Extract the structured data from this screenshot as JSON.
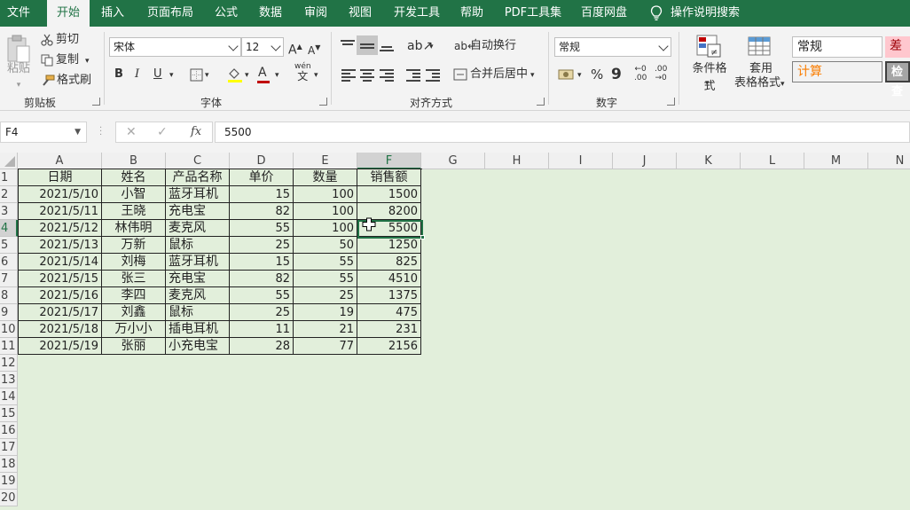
{
  "menu": {
    "tabs": [
      "文件",
      "开始",
      "插入",
      "页面布局",
      "公式",
      "数据",
      "审阅",
      "视图",
      "开发工具",
      "帮助",
      "PDF工具集",
      "百度网盘"
    ],
    "active": "开始",
    "search_label": "操作说明搜索"
  },
  "ribbon": {
    "clipboard": {
      "paste": "粘贴",
      "cut": "剪切",
      "copy": "复制",
      "format_painter": "格式刷",
      "label": "剪贴板"
    },
    "font": {
      "name": "宋体",
      "size": "12",
      "grow": "A",
      "shrink": "A",
      "bold": "B",
      "italic": "I",
      "underline": "U",
      "phonetic": "wén",
      "label": "字体"
    },
    "alignment": {
      "wrap": "自动换行",
      "merge": "合并后居中",
      "label": "对齐方式"
    },
    "number": {
      "format": "常规",
      "percent": "%",
      "comma": "9",
      "label": "数字"
    },
    "styles": {
      "conditional": "条件格式",
      "table_format_1": "套用",
      "table_format_2": "表格格式",
      "normal": "常规",
      "bad": "差",
      "calc": "计算",
      "check": "检查"
    }
  },
  "formula_bar": {
    "name_box": "F4",
    "cancel": "✕",
    "enter": "✓",
    "fx": "fx",
    "value": "5500"
  },
  "columns": [
    "A",
    "B",
    "C",
    "D",
    "E",
    "F",
    "G",
    "H",
    "I",
    "J",
    "K",
    "L",
    "M",
    "N"
  ],
  "rows": [
    "1",
    "2",
    "3",
    "4",
    "5",
    "6",
    "7",
    "8",
    "9",
    "10",
    "11",
    "12",
    "13",
    "14",
    "15",
    "16",
    "17",
    "18",
    "19",
    "20"
  ],
  "table": {
    "headers": [
      "日期",
      "姓名",
      "产品名称",
      "单价",
      "数量",
      "销售额"
    ],
    "rows": [
      [
        "2021/5/10",
        "小智",
        "蓝牙耳机",
        "15",
        "100",
        "1500"
      ],
      [
        "2021/5/11",
        "王晓",
        "充电宝",
        "82",
        "100",
        "8200"
      ],
      [
        "2021/5/12",
        "林伟明",
        "麦克风",
        "55",
        "100",
        "5500"
      ],
      [
        "2021/5/13",
        "万新",
        "鼠标",
        "25",
        "50",
        "1250"
      ],
      [
        "2021/5/14",
        "刘梅",
        "蓝牙耳机",
        "15",
        "55",
        "825"
      ],
      [
        "2021/5/15",
        "张三",
        "充电宝",
        "82",
        "55",
        "4510"
      ],
      [
        "2021/5/16",
        "李四",
        "麦克风",
        "55",
        "25",
        "1375"
      ],
      [
        "2021/5/17",
        "刘鑫",
        "鼠标",
        "25",
        "19",
        "475"
      ],
      [
        "2021/5/18",
        "万小小",
        "插电耳机",
        "11",
        "21",
        "231"
      ],
      [
        "2021/5/19",
        "张丽",
        "小充电宝",
        "28",
        "77",
        "2156"
      ]
    ]
  },
  "colors": {
    "accent": "#217346",
    "sheet_bg": "#e2efdb",
    "bad_bg": "#ffc7ce",
    "bad_fg": "#9c0006",
    "calc_fg": "#fa7d00"
  }
}
